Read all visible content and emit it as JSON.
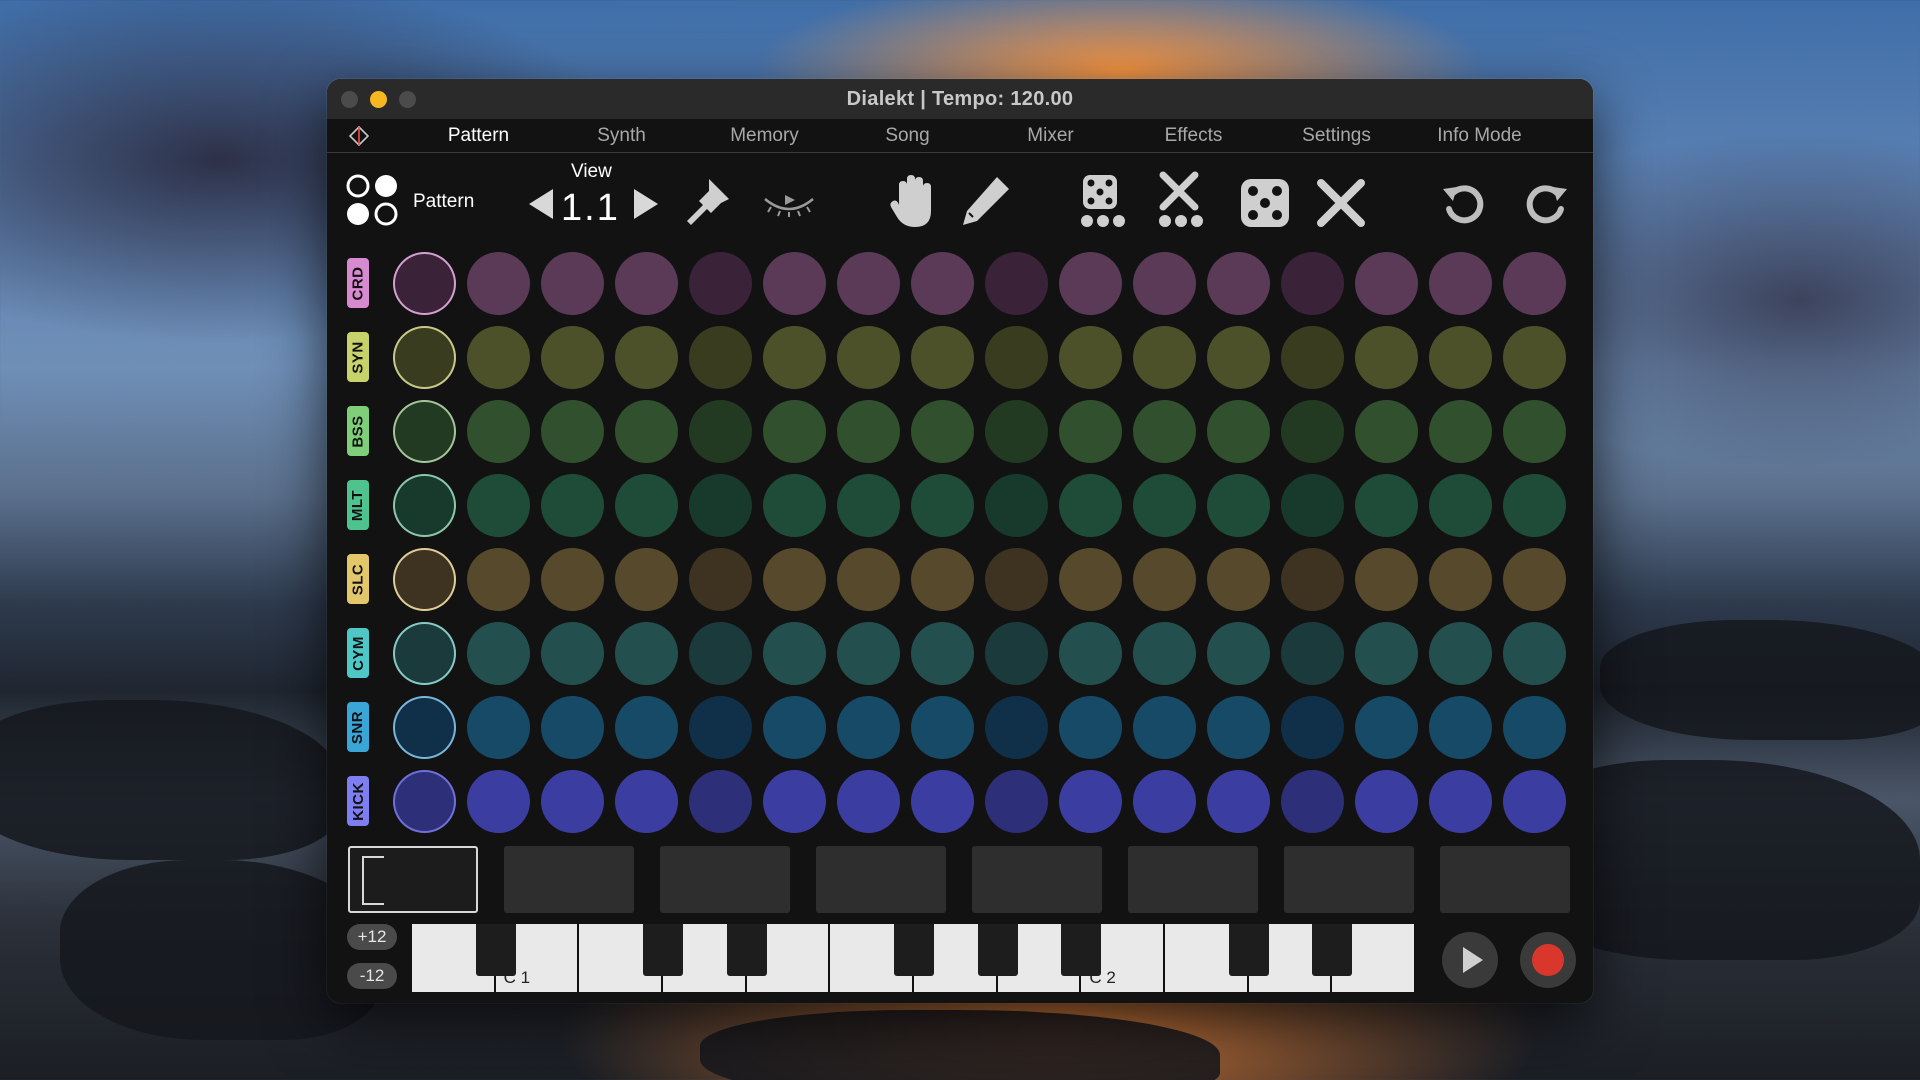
{
  "window": {
    "title": "Dialekt | Tempo: 120.00"
  },
  "menu": {
    "logo_icon": "dialekt-diamond-icon",
    "tabs": [
      {
        "label": "Pattern",
        "active": true
      },
      {
        "label": "Synth",
        "active": false
      },
      {
        "label": "Memory",
        "active": false
      },
      {
        "label": "Song",
        "active": false
      },
      {
        "label": "Mixer",
        "active": false
      },
      {
        "label": "Effects",
        "active": false
      },
      {
        "label": "Settings",
        "active": false
      },
      {
        "label": "Info Mode",
        "active": false
      }
    ]
  },
  "toolbar": {
    "pattern_label": "Pattern",
    "view_label": "View",
    "view_value": "1.1",
    "icons": [
      "pattern-grid-icon",
      "view-prev-icon",
      "view-next-icon",
      "pin-icon",
      "hidden-eye-icon",
      "hand-icon",
      "pencil-icon",
      "randomize-pattern-icon",
      "clear-pattern-icon",
      "randomize-icon",
      "clear-icon",
      "undo-icon",
      "redo-icon"
    ]
  },
  "tracks": [
    {
      "label": "CRD",
      "label_color": "#d88ad0",
      "ring": "#d3a0cf",
      "colors": {
        "dim": "#3a2338",
        "mid": "#5a3a56",
        "bright": "#6b4466"
      }
    },
    {
      "label": "SYN",
      "label_color": "#c6d36a",
      "ring": "#c8c889",
      "colors": {
        "dim": "#3a3c20",
        "mid": "#4d5129",
        "bright": "#5b602f"
      }
    },
    {
      "label": "BSS",
      "label_color": "#7fcf7a",
      "ring": "#a2c69a",
      "colors": {
        "dim": "#223a22",
        "mid": "#30502e",
        "bright": "#3a5e36"
      }
    },
    {
      "label": "MLT",
      "label_color": "#4fc38d",
      "ring": "#8ec6ac",
      "colors": {
        "dim": "#183a2c",
        "mid": "#1f4c39",
        "bright": "#255a42"
      }
    },
    {
      "label": "SLC",
      "label_color": "#e2c86b",
      "ring": "#ddcd98",
      "colors": {
        "dim": "#3d3320",
        "mid": "#57492c",
        "bright": "#6a5a34"
      }
    },
    {
      "label": "CYM",
      "label_color": "#4fc7c6",
      "ring": "#88c9c6",
      "colors": {
        "dim": "#1b3a3b",
        "mid": "#23504f",
        "bright": "#2a5e5c"
      }
    },
    {
      "label": "SNR",
      "label_color": "#3aa6d8",
      "ring": "#79b6d8",
      "colors": {
        "dim": "#0f3048",
        "mid": "#164a66",
        "bright": "#1a5675"
      }
    },
    {
      "label": "KICK",
      "label_color": "#7e7ef0",
      "ring": "#6f6fd8",
      "colors": {
        "dim": "#2d2f78",
        "mid": "#3b3ea0",
        "bright": "#4549b8"
      }
    }
  ],
  "step_pattern": [
    "sel",
    "mid",
    "mid",
    "mid",
    "dim",
    "mid",
    "mid",
    "mid",
    "dim",
    "mid",
    "mid",
    "mid",
    "dim",
    "mid",
    "mid",
    "mid"
  ],
  "pattern_slots": {
    "count": 8,
    "active_index": 0
  },
  "keyboard": {
    "transpose_up": "+12",
    "transpose_down": "-12",
    "octave_labels": [
      "C 1",
      "C 2"
    ]
  },
  "transport": {
    "play_icon": "play-icon",
    "record_icon": "record-icon",
    "record_color": "#d9372b"
  }
}
